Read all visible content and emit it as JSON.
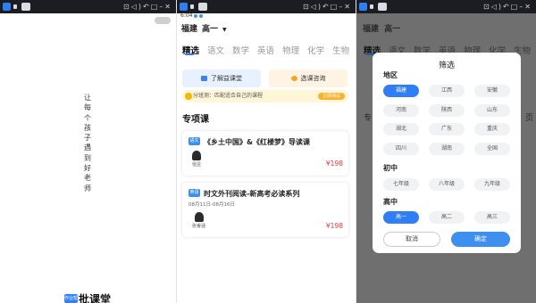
{
  "status_bar": {
    "icons": [
      "notification-icon",
      "volume-icon",
      "back-icon",
      "window-icon",
      "minimize-icon",
      "close-icon"
    ]
  },
  "splash": {
    "slogan": "让每个孩子遇到好老师",
    "logo_mark": "作业帮",
    "logo_text": "批课堂"
  },
  "app": {
    "time": "6:04",
    "location": "福建",
    "grade": "高一",
    "tabs": [
      "精选",
      "语文",
      "数学",
      "英语",
      "物理",
      "化学",
      "生物"
    ],
    "buttons": {
      "learn": "了解益课堂",
      "consult": "选课咨询"
    },
    "notice": {
      "text": "分班测：匹配适合自己的课程",
      "action": "立即测试"
    },
    "section_title": "专项课",
    "courses": [
      {
        "tag": "语文",
        "title": "《乡土中国》&《红楼梦》导读课",
        "date": "",
        "teacher": "徂昱",
        "price": "¥198"
      },
      {
        "tag": "英语",
        "title": "时文外刊阅读-新高考必读系列",
        "date": "08月11日-08月16日",
        "teacher": "张睿涵",
        "price": "¥198"
      }
    ]
  },
  "filter": {
    "title": "筛选",
    "region_label": "地区",
    "regions": [
      "福建",
      "江西",
      "安徽",
      "河南",
      "陕西",
      "山东",
      "湖北",
      "广东",
      "重庆",
      "四川",
      "湖南",
      "全国"
    ],
    "selected_region": "福建",
    "junior_label": "初中",
    "junior_grades": [
      "七年级",
      "八年级",
      "九年级"
    ],
    "senior_label": "高中",
    "senior_grades": [
      "高一",
      "高二",
      "高三"
    ],
    "selected_grade": "高一",
    "cancel": "取消",
    "confirm": "确定"
  },
  "background_peek": {
    "left": "专",
    "right": "页"
  },
  "colors": {
    "accent": "#2f7ef5",
    "price": "#e23b3b",
    "notice_bg": "#fff6d8",
    "overlay": "#6f6f6f"
  }
}
